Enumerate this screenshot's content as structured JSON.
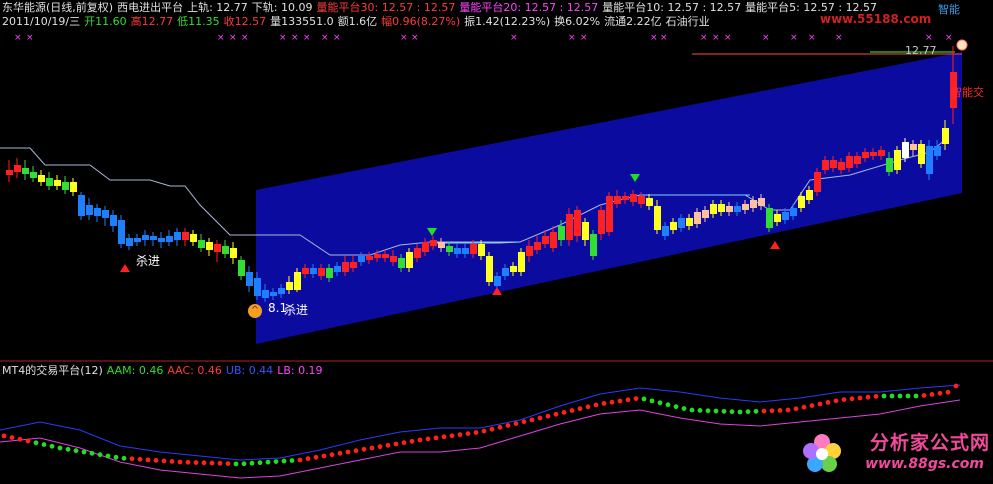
{
  "header": {
    "row1": [
      {
        "text": "东华能源(日线,前复权)",
        "color": "#e0e0e0"
      },
      {
        "text": "西电进出平台",
        "color": "#e0e0e0"
      },
      {
        "text": "上轨: 12.77",
        "color": "#e0e0e0"
      },
      {
        "text": "下轨: 10.09",
        "color": "#e0e0e0"
      },
      {
        "text": "量能平台30: 12.57 : 12.57",
        "color": "#ff3a3a"
      },
      {
        "text": "量能平台20: 12.57 : 12.57",
        "color": "#ff44ff"
      },
      {
        "text": "量能平台10: 12.57 : 12.57",
        "color": "#e0e0e0"
      },
      {
        "text": "量能平台5: 12.57 : 12.57",
        "color": "#e0e0e0"
      }
    ],
    "row2": [
      {
        "text": "2011/10/19/三",
        "color": "#e0e0e0"
      },
      {
        "text": "开11.60",
        "color": "#33dd33"
      },
      {
        "text": "高12.77",
        "color": "#ff3a3a"
      },
      {
        "text": "低11.35",
        "color": "#33dd33"
      },
      {
        "text": "收12.57",
        "color": "#ff3a3a"
      },
      {
        "text": "量133551.0",
        "color": "#e0e0e0"
      },
      {
        "text": "额1.6亿",
        "color": "#e0e0e0"
      },
      {
        "text": "幅0.96(8.27%)",
        "color": "#ff3a3a"
      },
      {
        "text": "振1.42(12.23%)",
        "color": "#e0e0e0"
      },
      {
        "text": "换6.02%",
        "color": "#e0e0e0"
      },
      {
        "text": "流通2.22亿",
        "color": "#e0e0e0"
      },
      {
        "text": "石油行业",
        "color": "#e0e0e0"
      }
    ],
    "top_right_label": "智能",
    "website": "www.55188.com"
  },
  "main_panel": {
    "price_label": "12.77",
    "right_clip_label": "智能交",
    "annotations": [
      {
        "text": "杀进",
        "color": "#ffffff"
      },
      {
        "text": "8.1",
        "color": "#ffffff"
      },
      {
        "text": "杀进",
        "color": "#ffffff"
      }
    ]
  },
  "sub_panel": {
    "title": "MT4的交易平台(12)",
    "items": [
      {
        "text": "AAM: 0.46",
        "color": "#33dd33"
      },
      {
        "text": "AAC: 0.46",
        "color": "#ff3a3a"
      },
      {
        "text": "UB: 0.44",
        "color": "#3355ff"
      },
      {
        "text": "LB: 0.19",
        "color": "#ff44ff"
      }
    ]
  },
  "watermark": {
    "logo": "分析家公式网",
    "url": "www.88gs.com"
  },
  "chart_data": {
    "type": "candlestick",
    "series": [
      {
        "name": "上轨",
        "last": 12.77
      },
      {
        "name": "下轨",
        "last": 10.09
      },
      {
        "name": "量能平台30",
        "last": 12.57
      },
      {
        "name": "量能平台20",
        "last": 12.57
      },
      {
        "name": "量能平台10",
        "last": 12.57
      },
      {
        "name": "量能平台5",
        "last": 12.57
      }
    ],
    "last_bar": {
      "open": 11.6,
      "high": 12.77,
      "low": 11.35,
      "close": 12.57
    },
    "indicator": {
      "name": "MT4的交易平台(12)",
      "AAM": 0.46,
      "AAC": 0.46,
      "UB": 0.44,
      "LB": 0.19
    },
    "colors": {
      "channel": "#0b0ba0",
      "up": "#ff2020",
      "down": "#20cc20",
      "blue_band": "#1e7fff",
      "yellow_band": "#ffff20",
      "pink_band": "#ffc0a0"
    }
  }
}
